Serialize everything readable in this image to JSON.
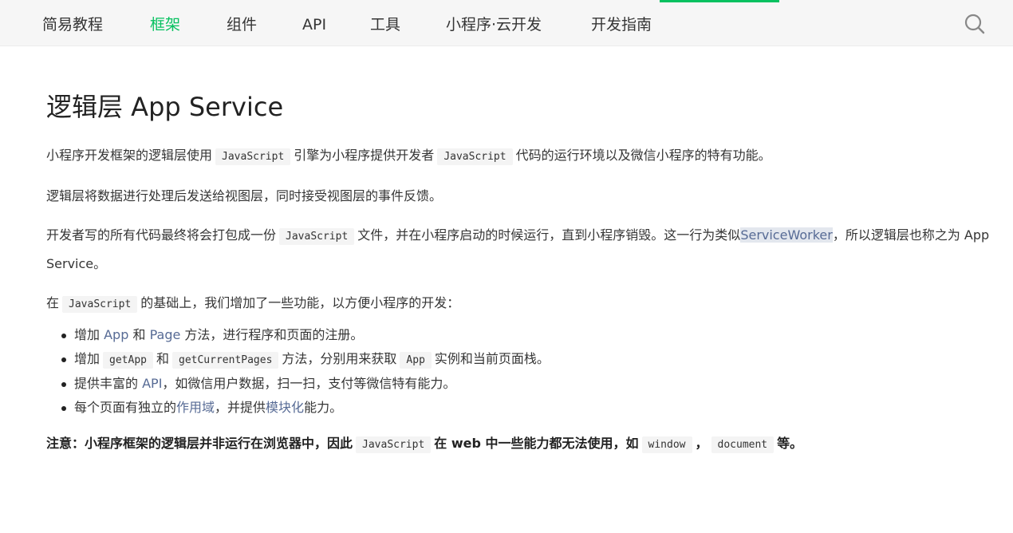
{
  "nav": {
    "items": [
      "简易教程",
      "框架",
      "组件",
      "API",
      "工具",
      "小程序·云开发",
      "开发指南"
    ],
    "active_index": 1,
    "active_color": "#07c160",
    "search_icon": "search-icon"
  },
  "article": {
    "title": "逻辑层 App Service",
    "p1": {
      "t1": "小程序开发框架的逻辑层使用",
      "c1": "JavaScript",
      "t2": "引擎为小程序提供开发者",
      "c2": "JavaScript",
      "t3": "代码的运行环境以及微信小程序的特有功能。"
    },
    "p2": "逻辑层将数据进行处理后发送给视图层，同时接受视图层的事件反馈。",
    "p3": {
      "t1": "开发者写的所有代码最终将会打包成一份",
      "c1": "JavaScript",
      "t2": "文件，并在小程序启动的时候运行，直到小程序销毁。这一行为类似",
      "link": "ServiceWorker",
      "t3": "，所以逻辑层也称之为 App Service。"
    },
    "p4": {
      "t1": "在",
      "c1": "JavaScript",
      "t2": "的基础上，我们增加了一些功能，以方便小程序的开发："
    },
    "list": {
      "item1": {
        "t1": "增加",
        "link1": "App",
        "t2": "和",
        "link2": "Page",
        "t3": "方法，进行程序和页面的注册。"
      },
      "item2": {
        "t1": "增加",
        "c1": "getApp",
        "t2": "和",
        "c2": "getCurrentPages",
        "t3": "方法，分别用来获取",
        "c3": "App",
        "t4": "实例和当前页面栈。"
      },
      "item3": {
        "t1": "提供丰富的",
        "link1": "API",
        "t2": "，如微信用户数据，扫一扫，支付等微信特有能力。"
      },
      "item4": {
        "t1": "每个页面有独立的",
        "link1": "作用域",
        "t2": "，并提供",
        "link2": "模块化",
        "t3": "能力。"
      }
    },
    "note": {
      "t1": "注意：小程序框架的逻辑层并非运行在浏览器中，因此",
      "c1": "JavaScript",
      "t2": "在 web 中一些能力都无法使用，如",
      "c2": "window",
      "t3": "，",
      "c3": "document",
      "t4": "等。"
    }
  },
  "colors": {
    "link": "#576b95",
    "accent": "#07c160"
  }
}
